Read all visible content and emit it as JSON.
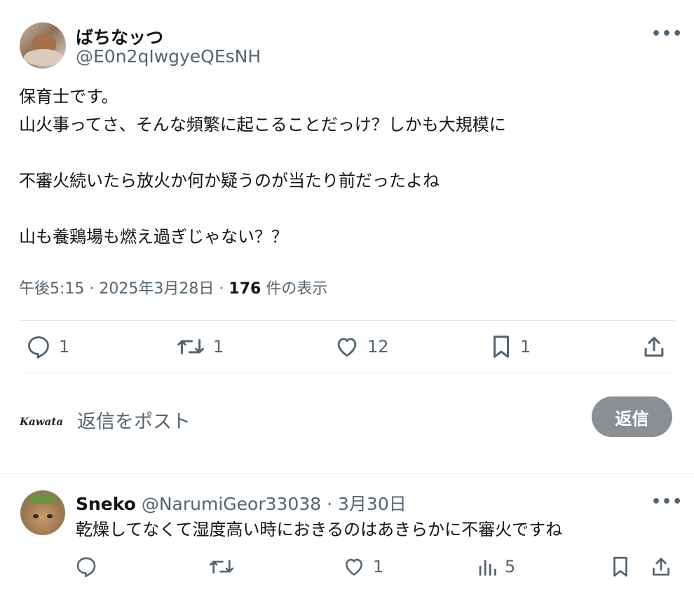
{
  "post": {
    "author_name": "ばちなッつ",
    "author_handle": "@E0n2qIwgyeQEsNH",
    "lines": [
      "保育士です。",
      "山火事ってさ、そんな頻繁に起こることだっけ？しかも大規模に",
      "",
      "不審火続いたら放火か何か疑うのが当たり前だったよね",
      "",
      "山も養鶏場も燃え過ぎじゃない？？"
    ],
    "time": "午後5:15",
    "date": "2025年3月28日",
    "views": "176",
    "views_label": "件の表示",
    "stats": {
      "replies": "1",
      "reposts": "1",
      "likes": "12",
      "bookmarks": "1"
    }
  },
  "composer": {
    "avatar_text": "Kawata",
    "placeholder": "返信をポスト",
    "reply_button": "返信"
  },
  "reply": {
    "author_name": "Sneko",
    "author_handle": "@NarumiGeor33038",
    "date": "3月30日",
    "text": "乾燥してなくて湿度高い時におきるのはあきらかに不審火ですね",
    "stats": {
      "likes": "1",
      "views": "5"
    }
  },
  "icons": {
    "more": "more-icon",
    "reply": "reply-icon",
    "repost": "repost-icon",
    "like": "heart-icon",
    "bookmark": "bookmark-icon",
    "share": "share-icon",
    "views": "views-icon"
  },
  "colors": {
    "text": "#0f1419",
    "muted": "#536471",
    "divider": "#e7e9ea",
    "reply_button_bg": "#8b8f93"
  }
}
